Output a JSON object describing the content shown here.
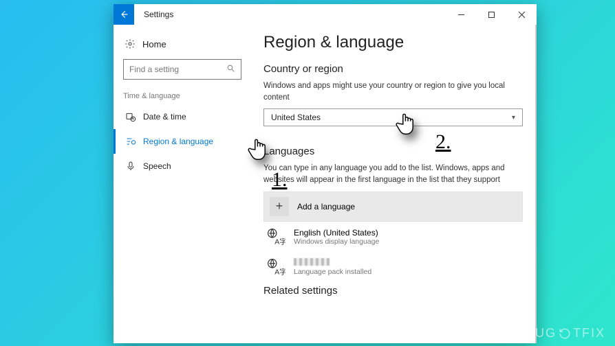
{
  "titlebar": {
    "title": "Settings"
  },
  "sidebar": {
    "home": "Home",
    "search_placeholder": "Find a setting",
    "group": "Time & language",
    "items": [
      {
        "label": "Date & time"
      },
      {
        "label": "Region & language"
      },
      {
        "label": "Speech"
      }
    ]
  },
  "content": {
    "heading": "Region & language",
    "country_section": "Country or region",
    "country_desc": "Windows and apps might use your country or region to give you local content",
    "country_value": "United States",
    "languages_section": "Languages",
    "languages_desc": "You can type in any language you add to the list. Windows, apps and websites will appear in the first language in the list that they support",
    "add_language": "Add a language",
    "langs": [
      {
        "name": "English (United States)",
        "sub": "Windows display language"
      },
      {
        "name": "",
        "sub": "Language pack installed"
      }
    ],
    "related_section": "Related settings"
  },
  "annotations": {
    "step1": "1.",
    "step2": "2."
  },
  "watermark": "UG⟳TFIX"
}
